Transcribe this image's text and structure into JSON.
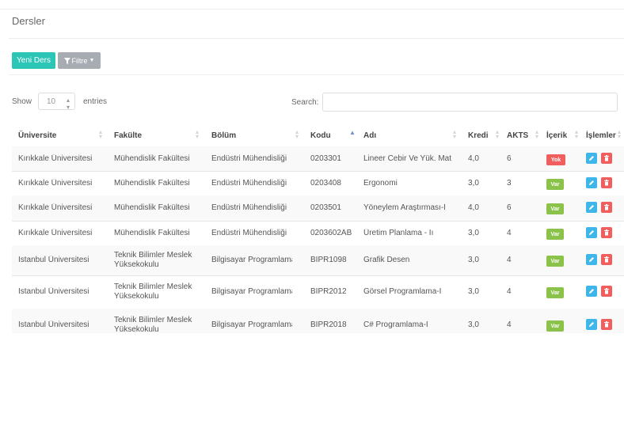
{
  "page": {
    "title": "Dersler"
  },
  "toolbar": {
    "new_label": "Yeni Ders",
    "filter_label": "Filtre"
  },
  "datatable": {
    "show_label": "Show",
    "page_size": "10",
    "entries_label": "entries",
    "search_label": "Search:",
    "search_value": ""
  },
  "columns": [
    "Üniversite",
    "Fakülte",
    "Bölüm",
    "Kodu",
    "Adı",
    "Kredi",
    "AKTS",
    "İçerik",
    "İşlemler"
  ],
  "rows": [
    {
      "uni": "Kırıkkale Üniversitesi",
      "fak": "Mühendislik Fakültesi",
      "bol": "Endüstri Mühendisliği",
      "kod": "0203301",
      "ad": "Lineer Cebir Ve Yük. Mat",
      "kredi": "4,0",
      "akts": "6",
      "icerik": "Yok"
    },
    {
      "uni": "Kırıkkale Üniversitesi",
      "fak": "Mühendislik Fakültesi",
      "bol": "Endüstri Mühendisliği",
      "kod": "0203408",
      "ad": "Ergonomi",
      "kredi": "3,0",
      "akts": "3",
      "icerik": "Var"
    },
    {
      "uni": "Kırıkkale Üniversitesi",
      "fak": "Mühendislik Fakültesi",
      "bol": "Endüstri Mühendisliği",
      "kod": "0203501",
      "ad": "Yöneylem Araştırması-I",
      "kredi": "4,0",
      "akts": "6",
      "icerik": "Var"
    },
    {
      "uni": "Kırıkkale Üniversitesi",
      "fak": "Mühendislik Fakültesi",
      "bol": "Endüstri Mühendisliği",
      "kod": "0203602AB",
      "ad": "Üretim Planlama - Iı",
      "kredi": "3,0",
      "akts": "4",
      "icerik": "Var"
    },
    {
      "uni": "İstanbul Üniversitesi",
      "fak": "Teknik Bilimler Meslek Yüksekokulu",
      "bol": "Bilgisayar Programlama",
      "kod": "BIPR1098",
      "ad": "Grafik Desen",
      "kredi": "3,0",
      "akts": "4",
      "icerik": "Var"
    },
    {
      "uni": "İstanbul Üniversitesi",
      "fak": "Teknik Bilimler Meslek Yüksekokulu",
      "bol": "Bilgisayar Programlama",
      "kod": "BIPR2012",
      "ad": "Görsel Programlama-I",
      "kredi": "3,0",
      "akts": "4",
      "icerik": "Var"
    },
    {
      "uni": "İstanbul Üniversitesi",
      "fak": "Teknik Bilimler Meslek Yüksekokulu",
      "bol": "Bilgisayar Programlama",
      "kod": "BIPR2018",
      "ad": "C# Programlama-I",
      "kredi": "3,0",
      "akts": "4",
      "icerik": "Var"
    }
  ],
  "colors": {
    "new_button": "#2cc5b6",
    "filter_button": "#a6acb1",
    "badge_yok": "#f05e5e",
    "badge_var": "#8bc34a",
    "edit": "#3eb6e9",
    "delete": "#f05e5e"
  },
  "icons": {
    "filter": "filter-icon",
    "caret": "caret-down-icon",
    "edit": "pencil-icon",
    "delete": "trash-icon"
  }
}
